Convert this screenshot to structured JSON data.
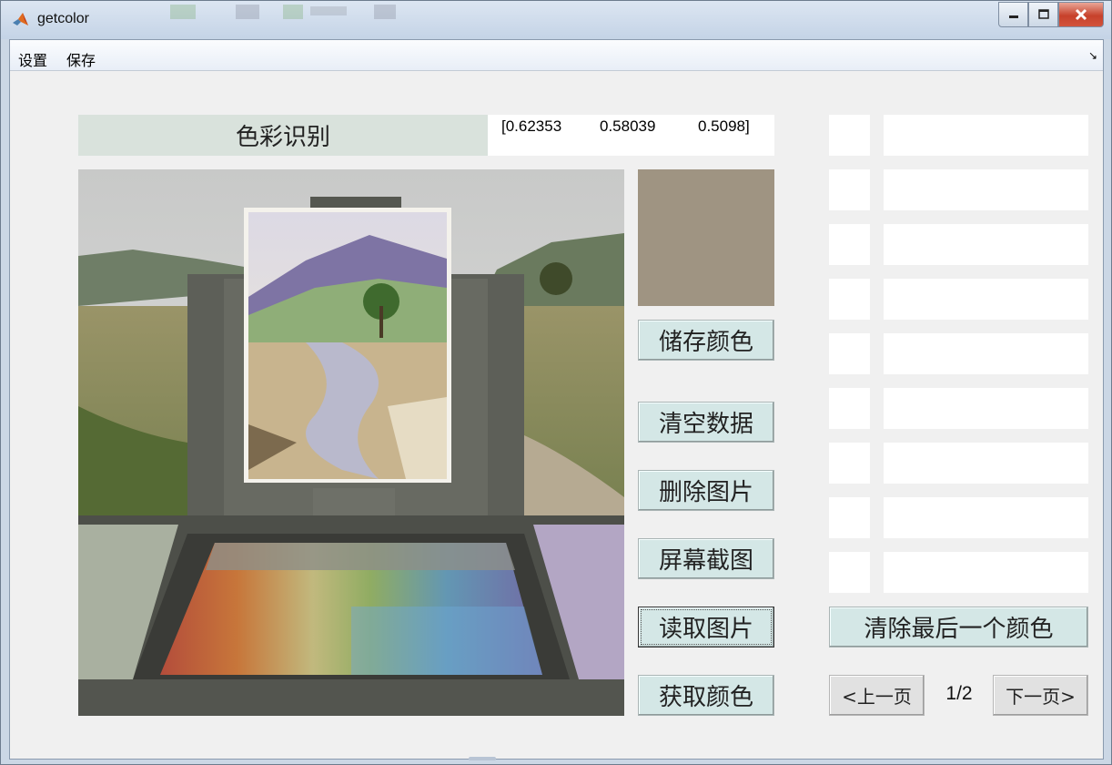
{
  "window": {
    "title": "getcolor"
  },
  "menu": {
    "items": [
      "设置",
      "保存"
    ]
  },
  "panel": {
    "title": "色彩识别",
    "rgb": [
      "[0.62353",
      "0.58039",
      "0.5098]"
    ],
    "current_color": "#9f9482"
  },
  "buttons": {
    "save_color": "储存颜色",
    "clear_data": "清空数据",
    "delete_image": "删除图片",
    "screenshot": "屏幕截图",
    "read_image": "读取图片",
    "get_color": "获取颜色",
    "clear_last_color": "清除最后一个颜色",
    "prev_page": "<上一页",
    "next_page": "下一页>"
  },
  "pagination": {
    "indicator": "1/2"
  },
  "icons": {
    "app": "matlab-logo-icon",
    "minimize": "minimize-icon",
    "maximize": "maximize-icon",
    "close": "close-icon",
    "menu_overflow": "menu-overflow-arrow-icon"
  }
}
